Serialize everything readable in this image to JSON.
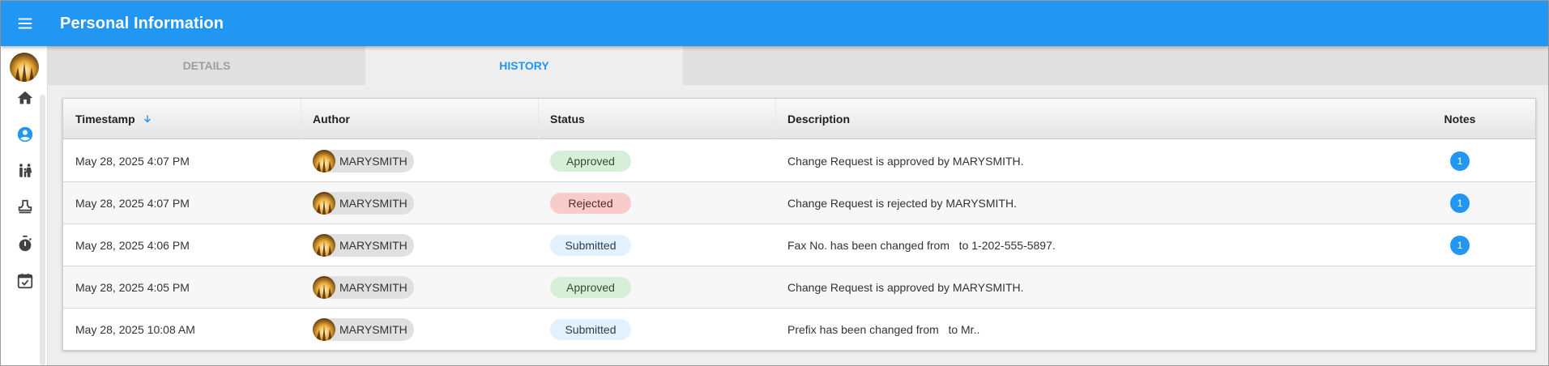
{
  "app": {
    "title": "Personal Information"
  },
  "tabs": [
    {
      "label": "DETAILS",
      "active": false
    },
    {
      "label": "HISTORY",
      "active": true
    }
  ],
  "rail": {
    "items": [
      "home-icon",
      "person-icon",
      "family-icon",
      "stamp-icon",
      "timer-icon",
      "calendar-check-icon"
    ],
    "active_item": "person-icon"
  },
  "table": {
    "columns": {
      "timestamp": "Timestamp",
      "author": "Author",
      "status": "Status",
      "description": "Description",
      "notes": "Notes"
    },
    "sort": {
      "column": "Timestamp",
      "direction": "descending"
    },
    "rows": [
      {
        "timestamp": "May 28, 2025 4:07 PM",
        "author": "MARYSMITH",
        "status": "Approved",
        "status_type": "approved",
        "description": "Change Request is approved by MARYSMITH.",
        "notes": "1"
      },
      {
        "timestamp": "May 28, 2025 4:07 PM",
        "author": "MARYSMITH",
        "status": "Rejected",
        "status_type": "rejected",
        "description": "Change Request is rejected by MARYSMITH.",
        "notes": "1"
      },
      {
        "timestamp": "May 28, 2025 4:06 PM",
        "author": "MARYSMITH",
        "status": "Submitted",
        "status_type": "submitted",
        "description": "Fax No. has been changed from   to 1-202-555-5897.",
        "notes": "1"
      },
      {
        "timestamp": "May 28, 2025 4:05 PM",
        "author": "MARYSMITH",
        "status": "Approved",
        "status_type": "approved",
        "description": "Change Request is approved by MARYSMITH.",
        "notes": ""
      },
      {
        "timestamp": "May 28, 2025 10:08 AM",
        "author": "MARYSMITH",
        "status": "Submitted",
        "status_type": "submitted",
        "description": "Prefix has been changed from   to Mr..",
        "notes": ""
      }
    ]
  },
  "colors": {
    "primary": "#2196f3",
    "approved_bg": "#d7efd9",
    "rejected_bg": "#f9cccc",
    "submitted_bg": "#e3f0fd"
  }
}
